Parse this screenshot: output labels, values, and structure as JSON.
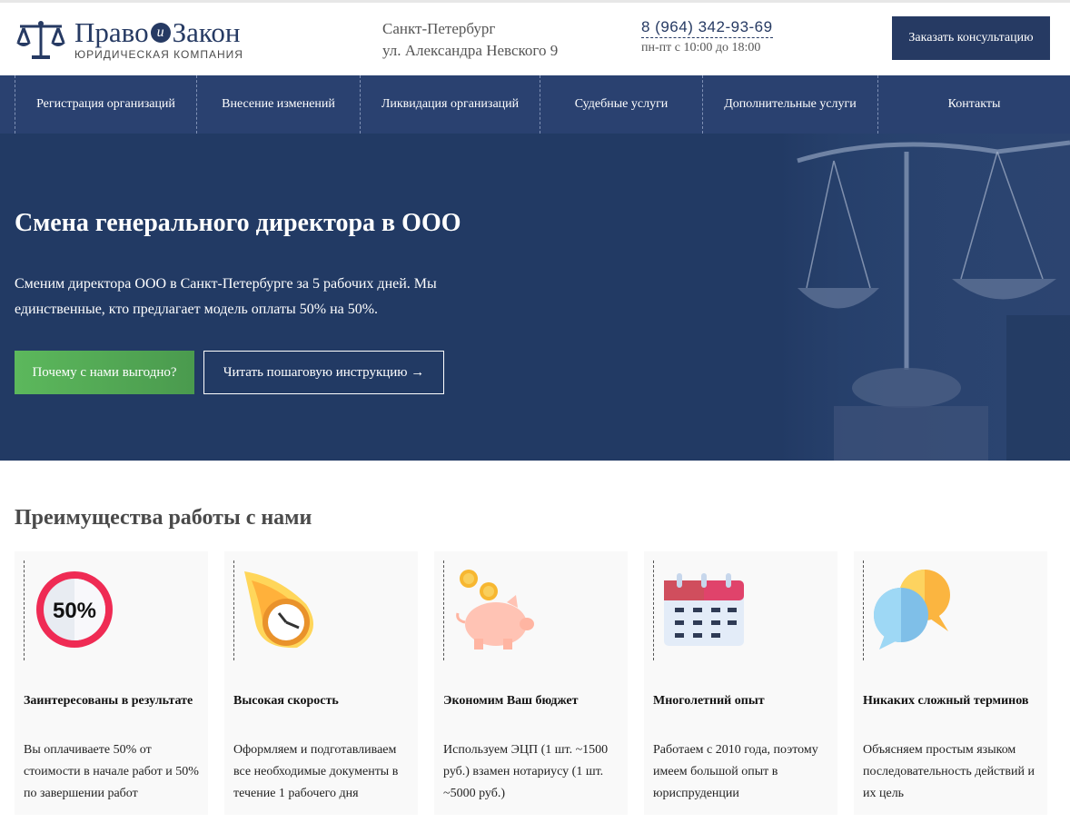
{
  "header": {
    "logo": {
      "name_left": "Право",
      "name_and": "и",
      "name_right": "Закон",
      "subtitle": "ЮРИДИЧЕСКАЯ КОМПАНИЯ"
    },
    "city": "Санкт-Петербург",
    "street": "ул. Александра Невского 9",
    "phone": "8 (964) 342-93-69",
    "hours": "пн-пт с 10:00 до 18:00",
    "consult_button": "Заказать консультацию"
  },
  "nav": {
    "items": [
      {
        "label": "Регистрация организаций"
      },
      {
        "label": "Внесение изменений"
      },
      {
        "label": "Ликвидация организаций"
      },
      {
        "label": "Судебные услуги"
      },
      {
        "label": "Дополнительные услуги"
      },
      {
        "label": "Контакты"
      }
    ]
  },
  "hero": {
    "title": "Смена генерального директора в ООО",
    "text": "Сменим директора ООО в Санкт-Петербурге за 5 рабочих дней. Мы единственные, кто предлагает модель оплаты 50% на 50%.",
    "primary_button": "Почему с нами выгодно?",
    "secondary_button": "Читать пошаговую инструкцию →"
  },
  "advantages": {
    "title": "Преимущества работы с нами",
    "cards": [
      {
        "icon": "percent-50-icon",
        "icon_text": "50%",
        "title": "Заинтересованы в результате",
        "text": "Вы оплачиваете 50% от стоимости в начале работ и 50% по завершении работ"
      },
      {
        "icon": "fast-clock-icon",
        "title": "Высокая скорость",
        "text": "Оформляем и подготавливаем все необходимые документы в течение 1 рабочего дня"
      },
      {
        "icon": "piggy-bank-icon",
        "title": "Экономим Ваш бюджет",
        "text": "Используем ЭЦП (1 шт. ~1500 руб.) взамен нотариусу (1 шт. ~5000 руб.)"
      },
      {
        "icon": "calendar-icon",
        "title": "Многолетний опыт",
        "text": "Работаем с 2010 года, поэтому имеем большой опыт в юриспруденции"
      },
      {
        "icon": "chat-bubbles-icon",
        "title": "Никаких сложный терминов",
        "text": "Объясняем простым языком последовательность действий и их цель"
      }
    ]
  },
  "colors": {
    "brand": "#263a63",
    "nav": "#2a4170",
    "hero": "#223a64",
    "green": "#5cb85c"
  }
}
